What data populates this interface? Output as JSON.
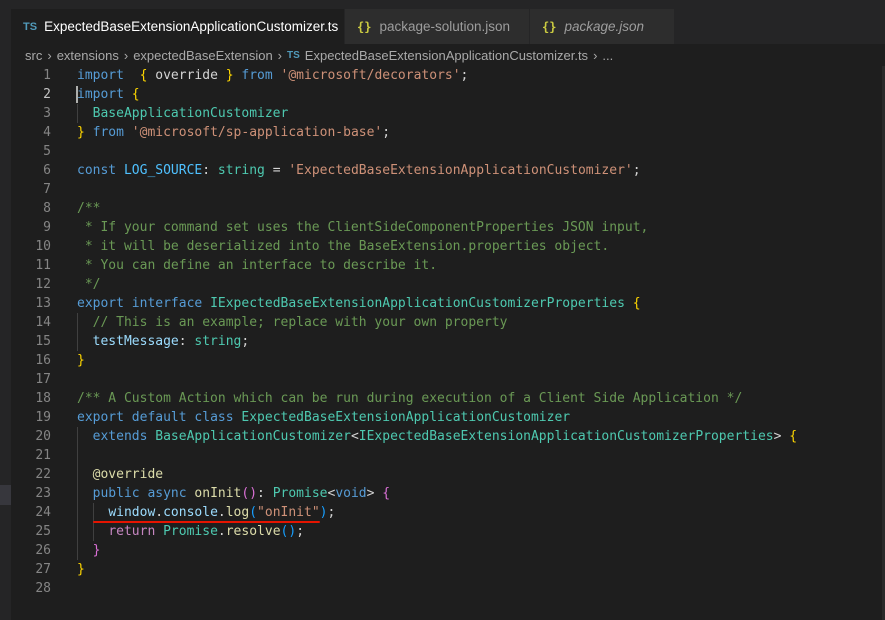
{
  "tabs": [
    {
      "icon": "TS",
      "label": "ExpectedBaseExtensionApplicationCustomizer.ts",
      "active": true,
      "dirty": true
    },
    {
      "icon": "{}",
      "label": "package-solution.json",
      "active": false
    },
    {
      "icon": "{}",
      "label": "package.json",
      "active": false,
      "italic": true
    }
  ],
  "breadcrumb": {
    "items": [
      "src",
      "extensions",
      "expectedBaseExtension"
    ],
    "file_icon": "TS",
    "file": "ExpectedBaseExtensionApplicationCustomizer.ts",
    "trailing": "..."
  },
  "editor": {
    "current_line": 2,
    "lines": [
      {
        "n": "1",
        "t": [
          [
            "kw",
            "import"
          ],
          [
            "",
            "  "
          ],
          [
            "br1",
            "{"
          ],
          [
            "",
            " override "
          ],
          [
            "br1",
            "}"
          ],
          [
            "",
            " "
          ],
          [
            "kw",
            "from"
          ],
          [
            "",
            " "
          ],
          [
            "str",
            "'@microsoft/decorators'"
          ],
          [
            "",
            ";"
          ]
        ]
      },
      {
        "n": "2",
        "t": [
          [
            "kw",
            "import"
          ],
          [
            "",
            " "
          ],
          [
            "br1",
            "{"
          ]
        ]
      },
      {
        "n": "3",
        "t": [
          [
            "",
            "  "
          ],
          [
            "ty",
            "BaseApplicationCustomizer"
          ]
        ]
      },
      {
        "n": "4",
        "t": [
          [
            "br1",
            "}"
          ],
          [
            "",
            " "
          ],
          [
            "kw",
            "from"
          ],
          [
            "",
            " "
          ],
          [
            "str",
            "'@microsoft/sp-application-base'"
          ],
          [
            "",
            ";"
          ]
        ]
      },
      {
        "n": "5",
        "t": []
      },
      {
        "n": "6",
        "t": [
          [
            "kw",
            "const"
          ],
          [
            "",
            " "
          ],
          [
            "cn",
            "LOG_SOURCE"
          ],
          [
            "",
            ": "
          ],
          [
            "ty",
            "string"
          ],
          [
            "",
            " = "
          ],
          [
            "str",
            "'ExpectedBaseExtensionApplicationCustomizer'"
          ],
          [
            "",
            ";"
          ]
        ]
      },
      {
        "n": "7",
        "t": []
      },
      {
        "n": "8",
        "t": [
          [
            "cm",
            "/**"
          ]
        ]
      },
      {
        "n": "9",
        "t": [
          [
            "cm",
            " * If your command set uses the ClientSideComponentProperties JSON input,"
          ]
        ]
      },
      {
        "n": "10",
        "t": [
          [
            "cm",
            " * it will be deserialized into the BaseExtension.properties object."
          ]
        ]
      },
      {
        "n": "11",
        "t": [
          [
            "cm",
            " * You can define an interface to describe it."
          ]
        ]
      },
      {
        "n": "12",
        "t": [
          [
            "cm",
            " */"
          ]
        ]
      },
      {
        "n": "13",
        "t": [
          [
            "kw",
            "export"
          ],
          [
            "",
            " "
          ],
          [
            "kw",
            "interface"
          ],
          [
            "",
            " "
          ],
          [
            "ty",
            "IExpectedBaseExtensionApplicationCustomizerProperties"
          ],
          [
            "",
            " "
          ],
          [
            "br1",
            "{"
          ]
        ]
      },
      {
        "n": "14",
        "t": [
          [
            "",
            "  "
          ],
          [
            "cm",
            "// This is an example; replace with your own property"
          ]
        ]
      },
      {
        "n": "15",
        "t": [
          [
            "",
            "  "
          ],
          [
            "var",
            "testMessage"
          ],
          [
            "",
            ": "
          ],
          [
            "ty",
            "string"
          ],
          [
            "",
            ";"
          ]
        ]
      },
      {
        "n": "16",
        "t": [
          [
            "br1",
            "}"
          ]
        ]
      },
      {
        "n": "17",
        "t": []
      },
      {
        "n": "18",
        "t": [
          [
            "cm",
            "/** A Custom Action which can be run during execution of a Client Side Application */"
          ]
        ]
      },
      {
        "n": "19",
        "t": [
          [
            "kw",
            "export"
          ],
          [
            "",
            " "
          ],
          [
            "kw",
            "default"
          ],
          [
            "",
            " "
          ],
          [
            "kw",
            "class"
          ],
          [
            "",
            " "
          ],
          [
            "ty",
            "ExpectedBaseExtensionApplicationCustomizer"
          ]
        ]
      },
      {
        "n": "20",
        "t": [
          [
            "",
            "  "
          ],
          [
            "kw",
            "extends"
          ],
          [
            "",
            " "
          ],
          [
            "ty",
            "BaseApplicationCustomizer"
          ],
          [
            "",
            "<"
          ],
          [
            "ty",
            "IExpectedBaseExtensionApplicationCustomizerProperties"
          ],
          [
            "",
            "> "
          ],
          [
            "br1",
            "{"
          ]
        ]
      },
      {
        "n": "21",
        "t": []
      },
      {
        "n": "22",
        "t": [
          [
            "",
            "  "
          ],
          [
            "dec",
            "@override"
          ]
        ]
      },
      {
        "n": "23",
        "t": [
          [
            "",
            "  "
          ],
          [
            "kw",
            "public"
          ],
          [
            "",
            " "
          ],
          [
            "kw",
            "async"
          ],
          [
            "",
            " "
          ],
          [
            "fn",
            "onInit"
          ],
          [
            "br2",
            "()"
          ],
          [
            "",
            ": "
          ],
          [
            "ty",
            "Promise"
          ],
          [
            "",
            "<"
          ],
          [
            "kw",
            "void"
          ],
          [
            "",
            "> "
          ],
          [
            "br2",
            "{"
          ]
        ]
      },
      {
        "n": "24",
        "t": [
          [
            "",
            "    "
          ],
          [
            "var",
            "window"
          ],
          [
            "",
            "."
          ],
          [
            "var",
            "console"
          ],
          [
            "",
            "."
          ],
          [
            "fn",
            "log"
          ],
          [
            "br3",
            "("
          ],
          [
            "str",
            "\"onInit\""
          ],
          [
            "br3",
            ")"
          ],
          [
            "",
            ";"
          ]
        ]
      },
      {
        "n": "25",
        "t": [
          [
            "",
            "    "
          ],
          [
            "ctl",
            "return"
          ],
          [
            "",
            " "
          ],
          [
            "ty",
            "Promise"
          ],
          [
            "",
            "."
          ],
          [
            "fn",
            "resolve"
          ],
          [
            "br3",
            "()"
          ],
          [
            "",
            ";"
          ]
        ]
      },
      {
        "n": "26",
        "t": [
          [
            "",
            "  "
          ],
          [
            "br2",
            "}"
          ]
        ]
      },
      {
        "n": "27",
        "t": [
          [
            "br1",
            "}"
          ]
        ]
      },
      {
        "n": "28",
        "t": []
      }
    ]
  },
  "colors": {
    "background": "#1e1e1e",
    "keyword": "#569cd6",
    "string": "#ce9178",
    "type": "#4ec9b0",
    "comment": "#6a9955",
    "error_underline": "#e51400"
  }
}
